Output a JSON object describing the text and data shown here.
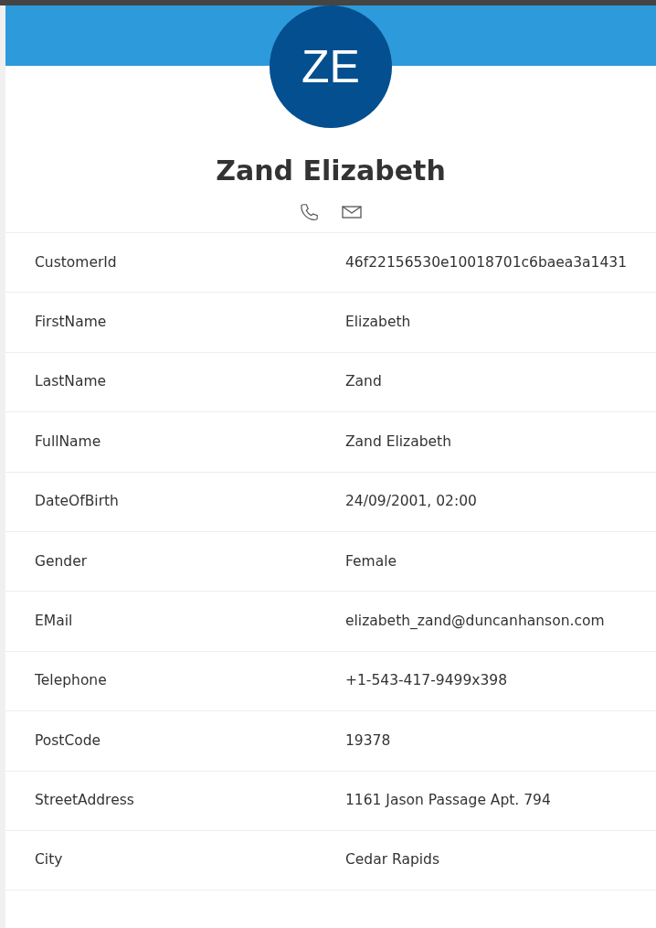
{
  "profile": {
    "initials": "ZE",
    "name": "Zand Elizabeth"
  },
  "fields": [
    {
      "label": "CustomerId",
      "value": "46f22156530e10018701c6baea3a1431"
    },
    {
      "label": "FirstName",
      "value": "Elizabeth"
    },
    {
      "label": "LastName",
      "value": "Zand"
    },
    {
      "label": "FullName",
      "value": "Zand Elizabeth"
    },
    {
      "label": "DateOfBirth",
      "value": "24/09/2001, 02:00"
    },
    {
      "label": "Gender",
      "value": "Female"
    },
    {
      "label": "EMail",
      "value": "elizabeth_zand@duncanhanson.com"
    },
    {
      "label": "Telephone",
      "value": "+1-543-417-9499x398"
    },
    {
      "label": "PostCode",
      "value": "19378"
    },
    {
      "label": "StreetAddress",
      "value": "1161 Jason Passage Apt. 794"
    },
    {
      "label": "City",
      "value": "Cedar Rapids"
    }
  ]
}
